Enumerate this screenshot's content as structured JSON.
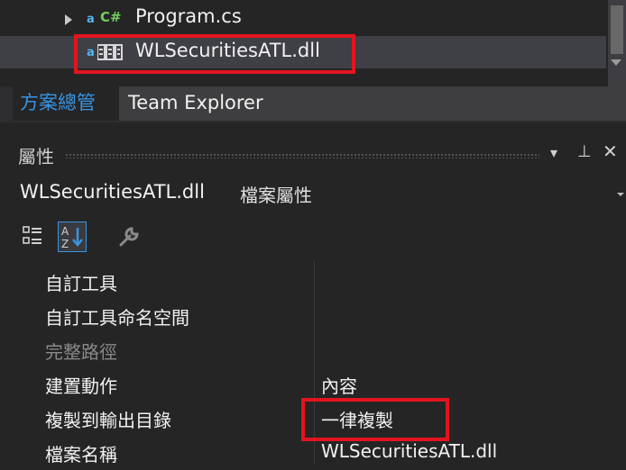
{
  "solution_explorer": {
    "items": [
      {
        "label": "Program.cs",
        "icon": "csharp-file-icon",
        "badge": "C#"
      },
      {
        "label": "WLSecuritiesATL.dll",
        "icon": "dll-reference-icon",
        "selected": true
      }
    ]
  },
  "tabs": {
    "solution_explorer": "方案總管",
    "team_explorer": "Team Explorer"
  },
  "properties": {
    "title": "屬性",
    "controls": {
      "dropdown": "▾",
      "pin": "⊥",
      "close": "✕"
    },
    "object_name": "WLSecuritiesATL.dll",
    "object_kind": "檔案屬性",
    "rows": [
      {
        "name": "自訂工具",
        "value": "",
        "disabled": false
      },
      {
        "name": "自訂工具命名空間",
        "value": "",
        "disabled": false
      },
      {
        "name": "完整路徑",
        "value": "",
        "disabled": true
      },
      {
        "name": "建置動作",
        "value": "內容",
        "disabled": false
      },
      {
        "name": "複製到輸出目錄",
        "value": "一律複製",
        "disabled": false,
        "highlighted": true
      },
      {
        "name": "檔案名稱",
        "value": "WLSecuritiesATL.dll",
        "disabled": false
      }
    ]
  },
  "colors": {
    "accent": "#3794e3",
    "highlight_box": "#e3141e",
    "background": "#252526"
  }
}
